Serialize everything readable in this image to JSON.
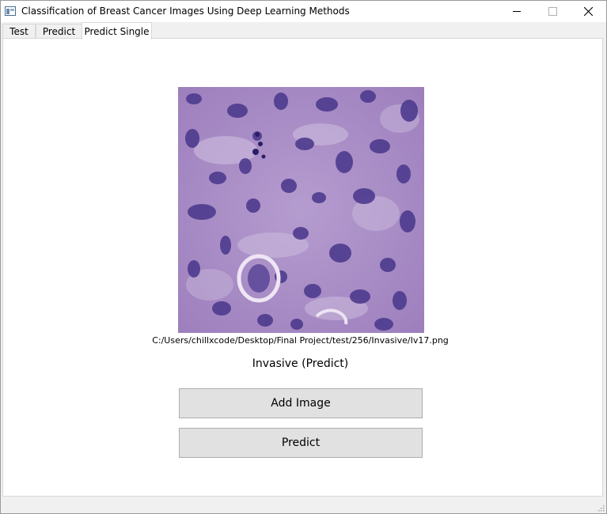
{
  "window": {
    "title": "Classification of Breast Cancer Images Using Deep Learning Methods"
  },
  "tabs": [
    {
      "label": "Test",
      "active": false
    },
    {
      "label": "Predict",
      "active": false
    },
    {
      "label": "Predict Single",
      "active": true
    }
  ],
  "predict_single": {
    "image_path": "C:/Users/chillxcode/Desktop/Final Project/test/256/Invasive/Iv17.png",
    "result": "Invasive (Predict)",
    "add_image_label": "Add Image",
    "predict_label": "Predict"
  },
  "icons": [
    "app-icon",
    "minimize-icon",
    "maximize-icon",
    "close-icon",
    "size-grip-icon"
  ],
  "colors": {
    "tissue_background": "#a989c4",
    "nucleus": "#4a3a8c",
    "button_bg": "#e1e1e1"
  }
}
